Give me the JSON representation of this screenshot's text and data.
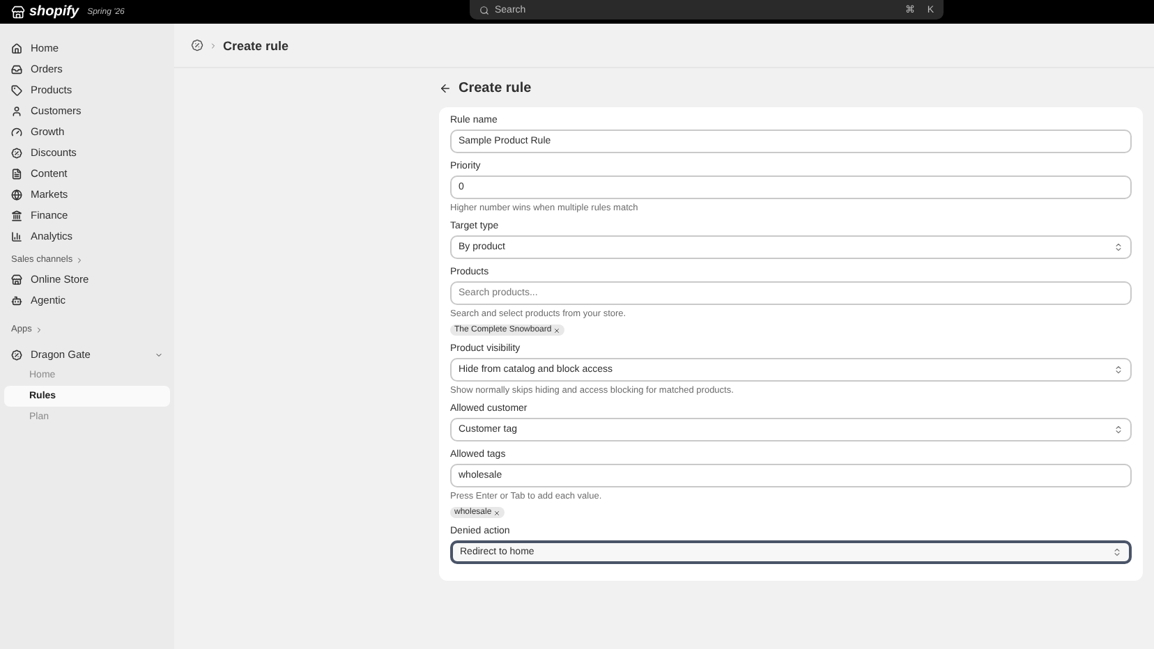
{
  "topbar": {
    "brand": "shopify",
    "edition": "Spring '26",
    "search": {
      "placeholder": "Search",
      "shortcut": [
        "⌘",
        "K"
      ]
    }
  },
  "sidebar": {
    "items": [
      {
        "label": "Home",
        "selected": false
      },
      {
        "label": "Orders",
        "selected": false
      },
      {
        "label": "Products",
        "selected": false
      },
      {
        "label": "Customers",
        "selected": false
      },
      {
        "label": "Growth",
        "selected": false
      },
      {
        "label": "Discounts",
        "selected": false
      },
      {
        "label": "Content",
        "selected": false
      },
      {
        "label": "Markets",
        "selected": false
      },
      {
        "label": "Finance",
        "selected": false
      },
      {
        "label": "Analytics",
        "selected": false
      }
    ],
    "sales_channels": {
      "heading": "Sales channels",
      "items": [
        {
          "label": "Online Store",
          "selected": false
        },
        {
          "label": "Agentic",
          "selected": false
        }
      ]
    },
    "apps": {
      "heading": "Apps",
      "app": {
        "label": "Dragon Gate",
        "expanded": true,
        "children": [
          {
            "label": "Home",
            "selected": false
          },
          {
            "label": "Rules",
            "selected": true
          },
          {
            "label": "Plan",
            "selected": false
          }
        ]
      }
    }
  },
  "breadcrumb": {
    "current": "Create rule"
  },
  "page": {
    "title": "Create rule",
    "fields": [
      {
        "kind": "text",
        "label": "Rule name",
        "value": "Sample Product Rule",
        "focused": false
      },
      {
        "kind": "text",
        "label": "Priority",
        "value": "0",
        "help": "Higher number wins when multiple rules match",
        "focused": false
      },
      {
        "kind": "select",
        "label": "Target type",
        "value": "By product",
        "focused": false
      },
      {
        "kind": "text",
        "label": "Products",
        "placeholder": "Search products...",
        "help": "Search and select products from your store.",
        "chips": [
          "The Complete Snowboard"
        ],
        "focused": false
      },
      {
        "kind": "select",
        "label": "Product visibility",
        "value": "Hide from catalog and block access",
        "help": "Show normally skips hiding and access blocking for matched products.",
        "focused": false
      },
      {
        "kind": "select",
        "label": "Allowed customer",
        "value": "Customer tag",
        "focused": false
      },
      {
        "kind": "text",
        "label": "Allowed tags",
        "value": "wholesale",
        "help": "Press Enter or Tab to add each value.",
        "chips": [
          "wholesale"
        ],
        "focused": false
      },
      {
        "kind": "select",
        "label": "Denied action",
        "value": "Redirect to home",
        "focused": true
      }
    ]
  }
}
